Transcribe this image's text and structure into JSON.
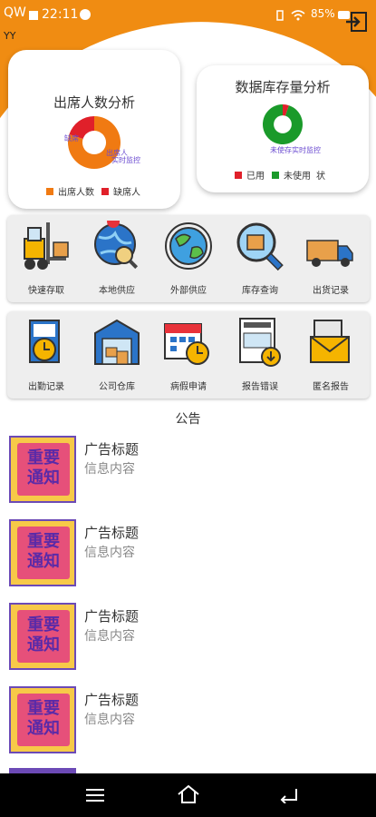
{
  "status": {
    "carrier": "QW",
    "time": "22:11",
    "battery": "85%"
  },
  "user": {
    "name": "YY"
  },
  "colors": {
    "brand": "#f08c12",
    "attend": "#f07a12",
    "absent": "#e0202a",
    "used": "#e0202a",
    "unused": "#1a9a2a"
  },
  "charts": [
    {
      "title": "出席人数分析",
      "labels": [
        "缺席",
        "出席人",
        "实时监控"
      ],
      "legend": [
        "出席人数",
        "缺席人"
      ]
    },
    {
      "title": "数据库存量分析",
      "labels": [
        "已用",
        "未使用",
        "未使存实时监控"
      ],
      "legend": [
        "已用",
        "未使用",
        "状"
      ]
    }
  ],
  "chart_data": [
    {
      "type": "pie",
      "title": "出席人数分析",
      "categories": [
        "出席人数",
        "缺席人数"
      ],
      "values": [
        80,
        20
      ]
    },
    {
      "type": "pie",
      "title": "数据库存量分析",
      "categories": [
        "已用",
        "未使用"
      ],
      "values": [
        5,
        95
      ]
    }
  ],
  "grid1": [
    {
      "label": "快速存取",
      "icon": "forklift-icon"
    },
    {
      "label": "本地供应",
      "icon": "globe-pin-icon"
    },
    {
      "label": "外部供应",
      "icon": "earth-icon"
    },
    {
      "label": "库存查询",
      "icon": "magnifier-box-icon"
    },
    {
      "label": "出货记录",
      "icon": "truck-icon"
    }
  ],
  "grid2": [
    {
      "label": "出勤记录",
      "icon": "clock-clipboard-icon"
    },
    {
      "label": "公司仓库",
      "icon": "warehouse-icon"
    },
    {
      "label": "病假申请",
      "icon": "calendar-clock-icon"
    },
    {
      "label": "报告错误",
      "icon": "invoice-icon"
    },
    {
      "label": "匿名报告",
      "icon": "envelope-icon"
    }
  ],
  "notice": {
    "title": "公告",
    "thumb_text": [
      "重要",
      "通知"
    ],
    "items": [
      {
        "title": "广告标题",
        "content": "信息内容"
      },
      {
        "title": "广告标题",
        "content": "信息内容"
      },
      {
        "title": "广告标题",
        "content": "信息内容"
      },
      {
        "title": "广告标题",
        "content": "信息内容"
      }
    ]
  }
}
